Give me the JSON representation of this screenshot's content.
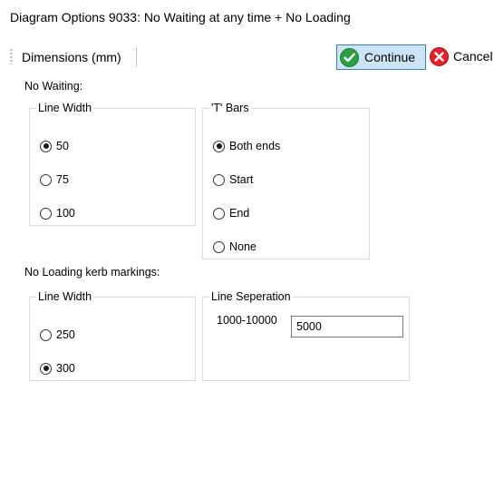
{
  "window": {
    "title": "Diagram Options 9033: No Waiting at any time + No Loading"
  },
  "toolbar": {
    "dimensions_label": "Dimensions (mm)",
    "continue_label": "Continue",
    "cancel_label": "Cancel",
    "continue_icon": "check-circle-icon",
    "cancel_icon": "close-circle-icon",
    "continue_color": "#2ea043",
    "cancel_color": "#e0222a"
  },
  "no_waiting": {
    "section_label": "No Waiting:",
    "line_width": {
      "legend": "Line Width",
      "options": [
        "50",
        "75",
        "100"
      ],
      "selected": "50"
    },
    "t_bars": {
      "legend": "'T' Bars",
      "options": [
        "Both ends",
        "Start",
        "End",
        "None"
      ],
      "selected": "Both ends"
    }
  },
  "no_loading": {
    "section_label": "No Loading kerb markings:",
    "line_width": {
      "legend": "Line Width",
      "options": [
        "250",
        "300"
      ],
      "selected": "300"
    },
    "line_separation": {
      "legend": "Line Seperation",
      "range_label": "1000-10000",
      "value": "5000"
    }
  }
}
